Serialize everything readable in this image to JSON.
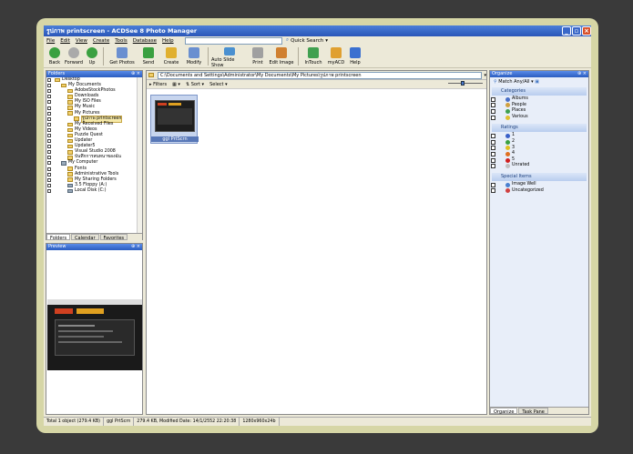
{
  "window": {
    "title": "รูปภาพ printscreen - ACDSee 8 Photo Manager"
  },
  "menu": [
    "File",
    "Edit",
    "View",
    "Create",
    "Tools",
    "Database",
    "Help"
  ],
  "quick_search": "Quick Search",
  "toolbar": [
    {
      "label": "Back",
      "icon": "back-arrow-icon",
      "color": "#3aa040"
    },
    {
      "label": "Forward",
      "icon": "forward-arrow-icon",
      "color": "#aaaaaa"
    },
    {
      "label": "Up",
      "icon": "up-arrow-icon",
      "color": "#3aa040"
    },
    {
      "label": "Get Photos",
      "icon": "get-photos-icon",
      "color": "#6a8fd0"
    },
    {
      "label": "Send",
      "icon": "send-icon",
      "color": "#3aa040"
    },
    {
      "label": "Create",
      "icon": "create-wand-icon",
      "color": "#e0b030"
    },
    {
      "label": "Modify",
      "icon": "modify-icon",
      "color": "#6a8fd0"
    },
    {
      "label": "Auto Slide Show",
      "icon": "slideshow-icon",
      "color": "#4a90d0"
    },
    {
      "label": "Print",
      "icon": "printer-icon",
      "color": "#a0a0a0"
    },
    {
      "label": "Edit Image",
      "icon": "edit-image-icon",
      "color": "#d08030"
    },
    {
      "label": "InTouch",
      "icon": "intouch-icon",
      "color": "#40a050"
    },
    {
      "label": "myACD",
      "icon": "myacd-icon",
      "color": "#e0a030"
    },
    {
      "label": "Help",
      "icon": "help-icon",
      "color": "#3a70d0"
    }
  ],
  "folders": {
    "title": "Folders",
    "items": [
      {
        "label": "Desktop",
        "level": 0,
        "type": "folder"
      },
      {
        "label": "My Documents",
        "level": 1,
        "type": "folder"
      },
      {
        "label": "AdobeStockPhotos",
        "level": 2,
        "type": "folder"
      },
      {
        "label": "Downloads",
        "level": 2,
        "type": "folder"
      },
      {
        "label": "My ISO Files",
        "level": 2,
        "type": "folder"
      },
      {
        "label": "My Music",
        "level": 2,
        "type": "folder"
      },
      {
        "label": "My Pictures",
        "level": 2,
        "type": "folder"
      },
      {
        "label": "รูปภาพ printscreen",
        "level": 3,
        "type": "folder",
        "selected": true
      },
      {
        "label": "My Received Files",
        "level": 2,
        "type": "folder"
      },
      {
        "label": "My Videos",
        "level": 2,
        "type": "folder"
      },
      {
        "label": "Puzzle Quest",
        "level": 2,
        "type": "folder"
      },
      {
        "label": "Updater",
        "level": 2,
        "type": "folder"
      },
      {
        "label": "Updater5",
        "level": 2,
        "type": "folder"
      },
      {
        "label": "Visual Studio 2008",
        "level": 2,
        "type": "folder"
      },
      {
        "label": "บันทึกการสนทนาของฉัน",
        "level": 2,
        "type": "folder"
      },
      {
        "label": "My Computer",
        "level": 1,
        "type": "drive"
      },
      {
        "label": "Fonts",
        "level": 2,
        "type": "folder"
      },
      {
        "label": "Administrative Tools",
        "level": 2,
        "type": "folder"
      },
      {
        "label": "My Sharing Folders",
        "level": 2,
        "type": "folder"
      },
      {
        "label": "3.5 Floppy (A:)",
        "level": 2,
        "type": "drive"
      },
      {
        "label": "Local Disk (C:)",
        "level": 2,
        "type": "drive"
      }
    ],
    "tabs": [
      "Folders",
      "Calendar",
      "Favorites"
    ]
  },
  "preview": {
    "title": "Preview"
  },
  "path": "C:\\Documents and Settings\\Administrator\\My Documents\\My Pictures\\รูปภาพ printscreen",
  "filterbar": {
    "filters": "Filters",
    "sort": "Sort",
    "select": "Select"
  },
  "thumbnail": {
    "label": "ggl PrtScrn"
  },
  "organize": {
    "title": "Organize",
    "match": "Match Any/All",
    "categories_title": "Categories",
    "categories": [
      {
        "label": "Albums",
        "color": "#4a70c8"
      },
      {
        "label": "People",
        "color": "#d0a040"
      },
      {
        "label": "Places",
        "color": "#40a050"
      },
      {
        "label": "Various",
        "color": "#e0c030"
      }
    ],
    "ratings_title": "Ratings",
    "ratings": [
      {
        "label": "1",
        "color": "#3a60c8"
      },
      {
        "label": "2",
        "color": "#3aa040"
      },
      {
        "label": "3",
        "color": "#e0c020"
      },
      {
        "label": "4",
        "color": "#e07020"
      },
      {
        "label": "5",
        "color": "#d02020"
      },
      {
        "label": "Unrated",
        "color": "#c0c0c0"
      }
    ],
    "special_title": "Special Items",
    "special": [
      {
        "label": "Image Well",
        "color": "#4a80d0"
      },
      {
        "label": "Uncategorized",
        "color": "#d04040"
      }
    ],
    "tabs": [
      "Organize",
      "Task Pane"
    ]
  },
  "status": [
    "Total 1 object  (279.4 KB)",
    "ggl PrtScrn",
    "279.4 KB, Modified Date: 14/1/2552 22:20:38",
    "1280x960x24b"
  ]
}
